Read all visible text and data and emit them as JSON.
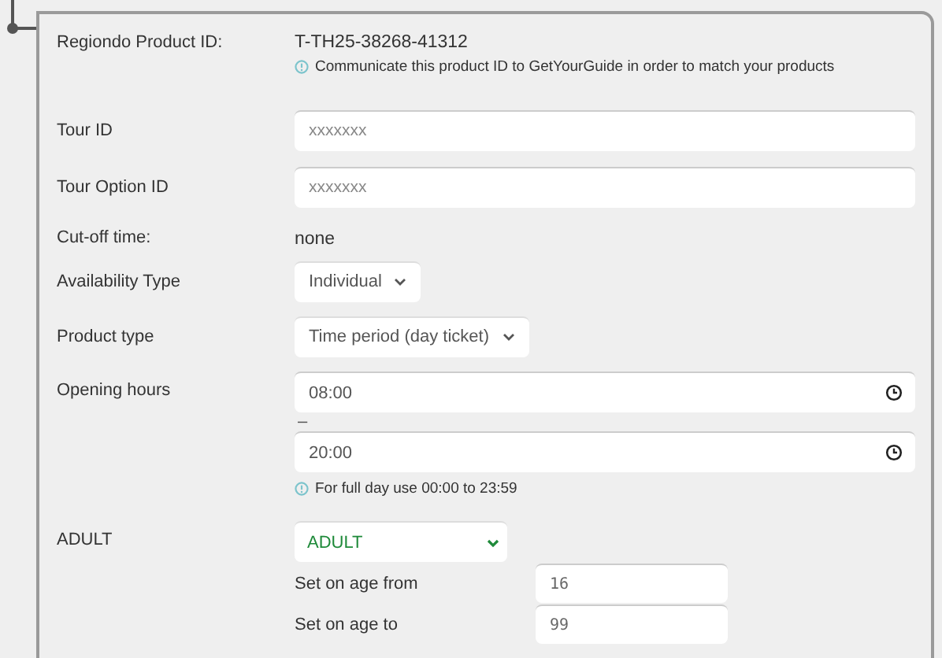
{
  "product_id": {
    "label": "Regiondo Product ID:",
    "value": "T-TH25-38268-41312",
    "hint": "Communicate this product ID to GetYourGuide in order to match your products"
  },
  "tour_id": {
    "label": "Tour ID",
    "placeholder": "xxxxxxx"
  },
  "tour_option_id": {
    "label": "Tour Option ID",
    "placeholder": "xxxxxxx"
  },
  "cutoff": {
    "label": "Cut-off time:",
    "value": "none"
  },
  "availability_type": {
    "label": "Availability Type",
    "value": "Individual"
  },
  "product_type": {
    "label": "Product type",
    "value": "Time period (day ticket)"
  },
  "opening_hours": {
    "label": "Opening hours",
    "from": "08:00",
    "separator": "–",
    "to": "20:00",
    "hint": "For full day use 00:00 to 23:59"
  },
  "age_group": {
    "label": "ADULT",
    "value": "ADULT",
    "age_from_label": "Set on age from",
    "age_from": "16",
    "age_to_label": "Set on age to",
    "age_to": "99"
  }
}
